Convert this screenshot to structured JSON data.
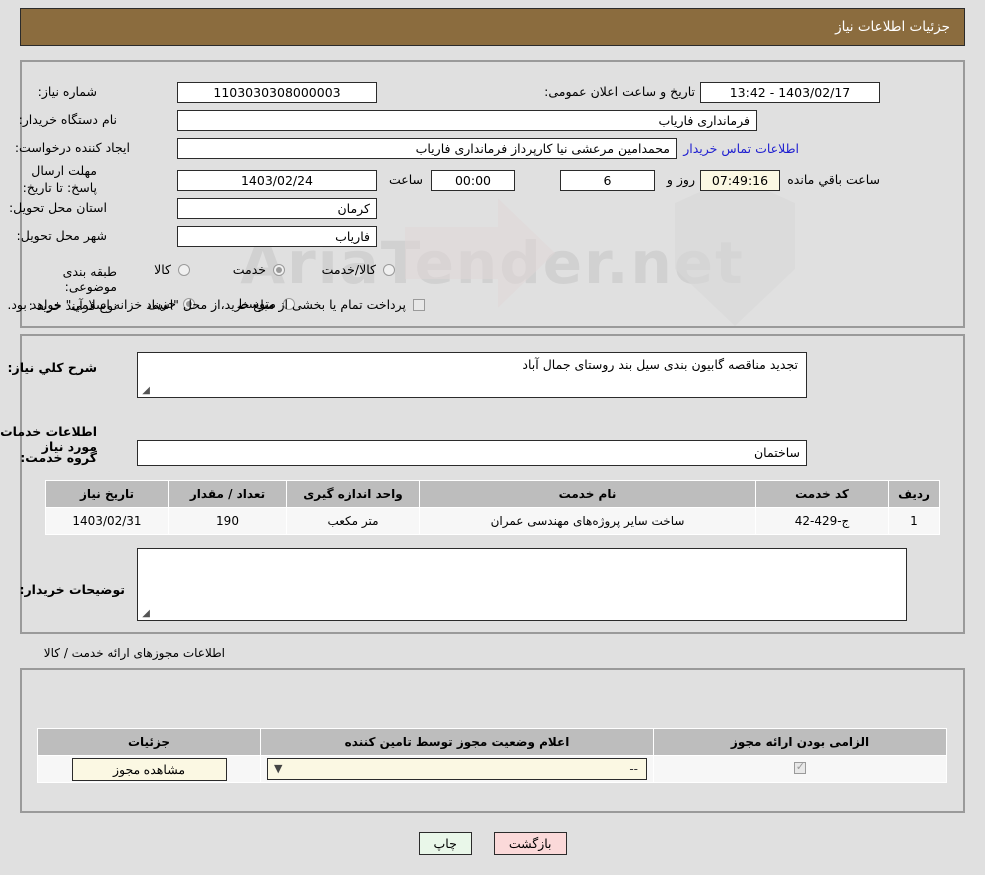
{
  "header": {
    "title": "جزئیات اطلاعات نیاز"
  },
  "watermark": {
    "text": "AriaTender.net"
  },
  "top_form": {
    "need_number_label": "شماره نیاز:",
    "need_number_value": "1103030308000003",
    "public_announce_label": "تاریخ و ساعت اعلان عمومی:",
    "public_announce_value": "1403/02/17 - 13:42",
    "buyer_org_label": "نام دستگاه خریدار:",
    "buyer_org_value": "فرمانداری فاریاب",
    "creator_label": "ایجاد کننده درخواست:",
    "creator_value": "محمدامین مرعشی نیا کارپرداز فرمانداری فاریاب",
    "contact_link": "اطلاعات تماس خریدار",
    "deadline_label": "مهلت ارسال پاسخ: تا تاریخ:",
    "deadline_date": "1403/02/24",
    "deadline_hour_label": "ساعت",
    "deadline_hour": "00:00",
    "remaining_days": "6",
    "remaining_days_label": "روز و",
    "remaining_time": "07:49:16",
    "remaining_time_label": "ساعت باقي مانده",
    "province_label": "استان محل تحویل:",
    "province_value": "کرمان",
    "city_label": "شهر محل تحویل:",
    "city_value": "فاریاب",
    "category_label": "طبقه بندی موضوعی:",
    "category_options": [
      {
        "label": "کالا",
        "selected": false
      },
      {
        "label": "خدمت",
        "selected": true
      },
      {
        "label": "کالا/خدمت",
        "selected": false
      }
    ],
    "process_label": "نوع فرآیند خرید :",
    "process_options": [
      {
        "label": "جزیی",
        "selected": true
      },
      {
        "label": "متوسط",
        "selected": false
      }
    ],
    "treasury_checkbox_checked": false,
    "treasury_note": "پرداخت تمام یا بخشی از مبلغ خرید،از محل \"اسناد خزانه اسلامی\" خواهد بود."
  },
  "middle": {
    "need_desc_label": "شرح کلي نیاز:",
    "need_desc_value": "تجدید مناقصه گابیون بندی سیل بند روستای جمال آباد",
    "services_section_label": "اطلاعات خدمات مورد نیاز",
    "service_group_label": "گروه خدمت:",
    "service_group_value": "ساختمان",
    "services_table": {
      "columns": [
        "ردیف",
        "کد خدمت",
        "نام خدمت",
        "واحد اندازه گیری",
        "تعداد / مقدار",
        "تاریخ نیاز"
      ],
      "rows": [
        {
          "row": "1",
          "code": "ج-429-42",
          "name": "ساخت سایر پروژه‌های مهندسی عمران",
          "unit": "متر مکعب",
          "quantity": "190",
          "need_date": "1403/02/31"
        }
      ]
    },
    "buyer_notes_label": "توضیحات خریدار:",
    "buyer_notes_value": ""
  },
  "licenses": {
    "section_label": "اطلاعات مجوزهای ارائه خدمت / کالا",
    "table": {
      "columns": [
        "الزامی بودن ارائه مجوز",
        "اعلام وضعیت مجوز توسط تامین کننده",
        "جزئیات"
      ],
      "rows": [
        {
          "required_checked": true,
          "status_value": "--",
          "details_button": "مشاهده مجوز"
        }
      ]
    }
  },
  "footer": {
    "print_button": "چاپ",
    "back_button": "بازگشت"
  },
  "colors": {
    "header_brown": "#8b6c3e",
    "page_bg": "#e0e0e0",
    "link_blue": "#2020d0",
    "table_header_gray": "#bdbdbd",
    "cream": "#fbf8e3",
    "print_green": "#e9f7e9",
    "back_pink": "#fbd9d9"
  }
}
